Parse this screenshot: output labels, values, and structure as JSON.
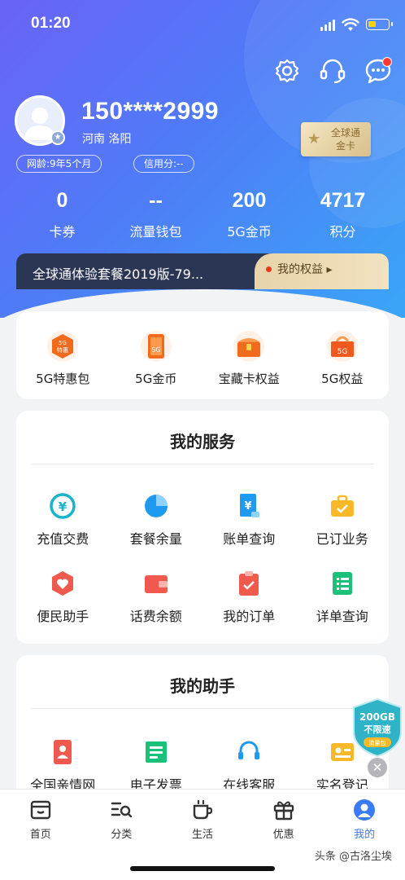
{
  "status": {
    "time": "01:20"
  },
  "profile": {
    "phone": "150****2999",
    "location": "河南 洛阳",
    "net_age": "网龄:9年5个月",
    "credit": "信用分:--",
    "card_badge": "全球通\n金卡"
  },
  "stats": [
    {
      "value": "0",
      "label": "卡券"
    },
    {
      "value": "--",
      "label": "流量钱包"
    },
    {
      "value": "200",
      "label": "5G金币"
    },
    {
      "value": "4717",
      "label": "积分"
    }
  ],
  "package": {
    "name": "全球通体验套餐2019版-79...",
    "rights_label": "我的权益 ▸"
  },
  "quick": [
    {
      "label": "5G特惠包",
      "icon": "5g-discount-icon"
    },
    {
      "label": "5G金币",
      "icon": "5g-coin-icon"
    },
    {
      "label": "宝藏卡权益",
      "icon": "treasure-card-icon"
    },
    {
      "label": "5G权益",
      "icon": "5g-rights-icon"
    }
  ],
  "quick_icon_text": {
    "discount": "5G\n特惠",
    "coin": "5G",
    "rights": "5G"
  },
  "services": {
    "title": "我的服务",
    "items": [
      {
        "label": "充值交费",
        "icon": "recharge-icon"
      },
      {
        "label": "套餐余量",
        "icon": "pie-chart-icon"
      },
      {
        "label": "账单查询",
        "icon": "bill-icon"
      },
      {
        "label": "已订业务",
        "icon": "briefcase-icon"
      },
      {
        "label": "便民助手",
        "icon": "heart-shield-icon"
      },
      {
        "label": "话费余额",
        "icon": "wallet-icon"
      },
      {
        "label": "我的订单",
        "icon": "order-icon"
      },
      {
        "label": "详单查询",
        "icon": "list-icon"
      }
    ]
  },
  "assistant": {
    "title": "我的助手",
    "items": [
      {
        "label": "全国亲情网",
        "icon": "family-icon"
      },
      {
        "label": "电子发票",
        "icon": "invoice-icon"
      },
      {
        "label": "在线客服",
        "icon": "headset-icon"
      },
      {
        "label": "实名登记",
        "icon": "id-card-icon"
      }
    ]
  },
  "float_badge": {
    "line1": "200GB",
    "line2": "不限速",
    "line3": "流量包"
  },
  "tabs": [
    {
      "label": "首页",
      "icon": "home-icon"
    },
    {
      "label": "分类",
      "icon": "category-icon"
    },
    {
      "label": "生活",
      "icon": "cup-icon"
    },
    {
      "label": "优惠",
      "icon": "gift-icon"
    },
    {
      "label": "我的",
      "icon": "user-icon",
      "active": true
    }
  ],
  "watermark": "头条 @古洛尘埃",
  "colors": {
    "accent": "#3a7bfa",
    "gradient_start": "#6a63f6",
    "gradient_end": "#3aa6f7",
    "package_bar": "#2b3554"
  }
}
